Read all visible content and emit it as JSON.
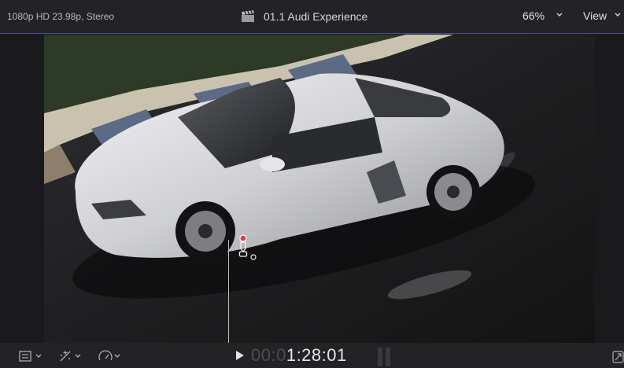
{
  "header": {
    "format": "1080p HD 23.98p, Stereo",
    "title": "01.1 Audi Experience",
    "zoom": "66%",
    "view_label": "View"
  },
  "timecode": {
    "dim": "00:0",
    "lit": "1:28:01"
  },
  "icons": {
    "clip": "clapperboard-icon",
    "viewer_options": "layout-icon",
    "transform": "transform-icon",
    "retime": "speedometer-icon",
    "play": "play-icon",
    "fullscreen": "fullscreen-icon",
    "marker": "pen-marker-icon"
  },
  "colors": {
    "accent_line": "#4b4e9b",
    "marker_red": "#e23b3b"
  }
}
